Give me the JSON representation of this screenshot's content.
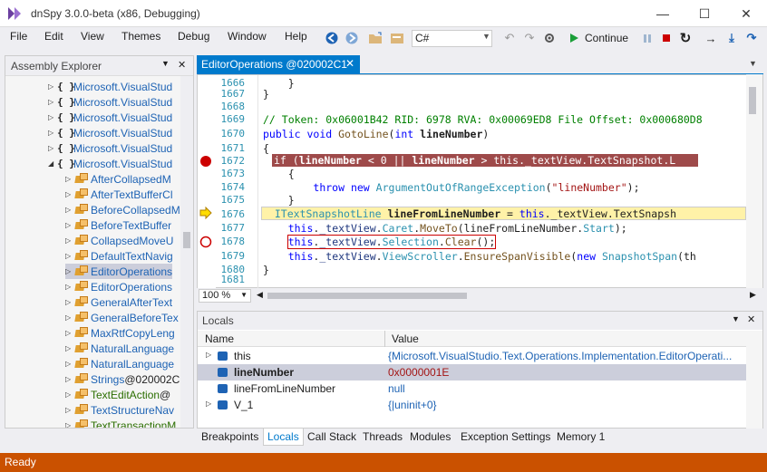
{
  "window": {
    "title": "dnSpy 3.0.0-beta (x86, Debugging)",
    "minimize": "—",
    "maximize": "☐",
    "close": "✕"
  },
  "menu": [
    "File",
    "Edit",
    "View",
    "Themes",
    "Debug",
    "Window",
    "Help"
  ],
  "toolbar": {
    "language": "C#",
    "continue_label": "Continue"
  },
  "assembly_explorer": {
    "title": "Assembly Explorer",
    "items": [
      {
        "label": "Microsoft.VisualStud",
        "kind": "ns",
        "expanded": false
      },
      {
        "label": "Microsoft.VisualStud",
        "kind": "ns",
        "expanded": false
      },
      {
        "label": "Microsoft.VisualStud",
        "kind": "ns",
        "expanded": false
      },
      {
        "label": "Microsoft.VisualStud",
        "kind": "ns",
        "expanded": false
      },
      {
        "label": "Microsoft.VisualStud",
        "kind": "ns",
        "expanded": false
      },
      {
        "label": "Microsoft.VisualStud",
        "kind": "ns",
        "expanded": true
      },
      {
        "label": "AfterCollapsedM",
        "kind": "cls"
      },
      {
        "label": "AfterTextBufferCl",
        "kind": "cls"
      },
      {
        "label": "BeforeCollapsedM",
        "kind": "cls"
      },
      {
        "label": "BeforeTextBuffer",
        "kind": "cls"
      },
      {
        "label": "CollapsedMoveU",
        "kind": "cls"
      },
      {
        "label": "DefaultTextNavig",
        "kind": "cls"
      },
      {
        "label": "EditorOperations",
        "kind": "cls",
        "selected": true
      },
      {
        "label": "EditorOperations",
        "kind": "cls"
      },
      {
        "label": "GeneralAfterText",
        "kind": "cls"
      },
      {
        "label": "GeneralBeforeTex",
        "kind": "cls"
      },
      {
        "label": "MaxRtfCopyLeng",
        "kind": "cls"
      },
      {
        "label": "NaturalLanguage",
        "kind": "cls"
      },
      {
        "label": "NaturalLanguage",
        "kind": "cls"
      },
      {
        "label": "Strings",
        "suffix": " @020002C",
        "kind": "cls"
      },
      {
        "label": "TextEditAction",
        "suffix": " @",
        "kind": "cls",
        "dark": true
      },
      {
        "label": "TextStructureNav",
        "kind": "cls"
      },
      {
        "label": "TextTransactionM",
        "kind": "cls",
        "dark": true
      }
    ]
  },
  "editor": {
    "tab_label": "EditorOperations @020002C1",
    "tab_close": "✕",
    "line_numbers": [
      "1666",
      "1667",
      "1668",
      "1669",
      "1670",
      "1671",
      "1672",
      "1673",
      "1674",
      "1675",
      "1676",
      "1677",
      "1678",
      "1679",
      "1680",
      "1681"
    ],
    "comment": "// Token: 0x06001B42 RID: 6978 RVA: 0x00069ED8 File Offset: 0x000680D8",
    "zoom": "100 %"
  },
  "locals": {
    "title": "Locals",
    "columns": [
      "Name",
      "Value"
    ],
    "rows": [
      {
        "name": "this",
        "value": "{Microsoft.VisualStudio.Text.Operations.Implementation.EditorOperati...",
        "expandable": true
      },
      {
        "name": "lineNumber",
        "value": "0x0000001E",
        "selected": true
      },
      {
        "name": "lineFromLineNumber",
        "value": "null"
      },
      {
        "name": "V_1",
        "value": "{|uninit+0}",
        "expandable": true
      }
    ]
  },
  "bottom_tabs": [
    "Breakpoints",
    "Locals",
    "Call Stack",
    "Threads",
    "Modules",
    "Exception Settings",
    "Memory 1"
  ],
  "status": "Ready"
}
